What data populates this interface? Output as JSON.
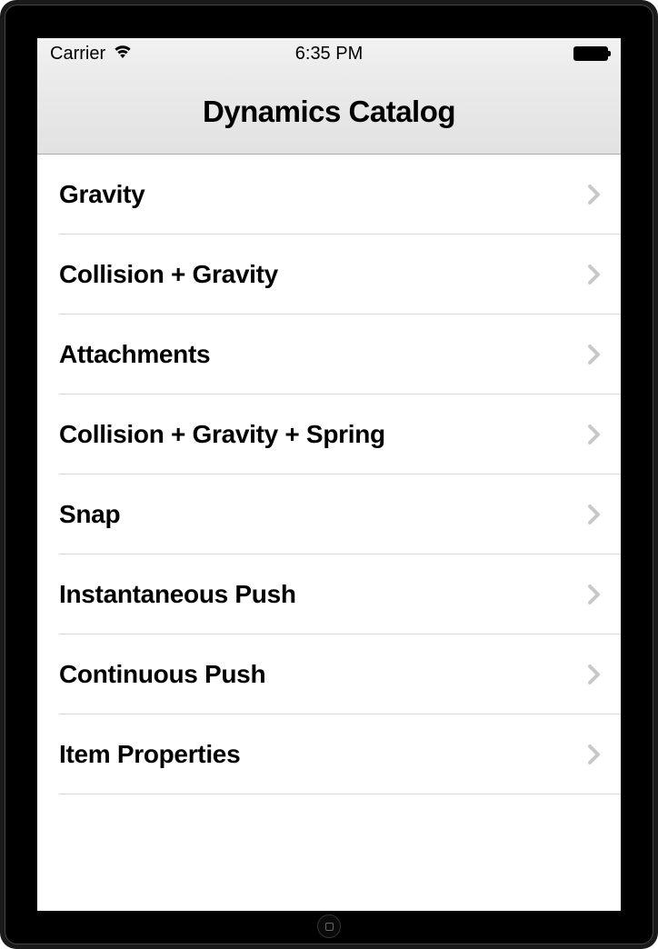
{
  "status_bar": {
    "carrier": "Carrier",
    "time": "6:35 PM"
  },
  "nav": {
    "title": "Dynamics Catalog"
  },
  "items": [
    {
      "label": "Gravity"
    },
    {
      "label": "Collision + Gravity"
    },
    {
      "label": "Attachments"
    },
    {
      "label": "Collision + Gravity  + Spring"
    },
    {
      "label": "Snap"
    },
    {
      "label": "Instantaneous Push"
    },
    {
      "label": "Continuous Push"
    },
    {
      "label": "Item Properties"
    }
  ]
}
